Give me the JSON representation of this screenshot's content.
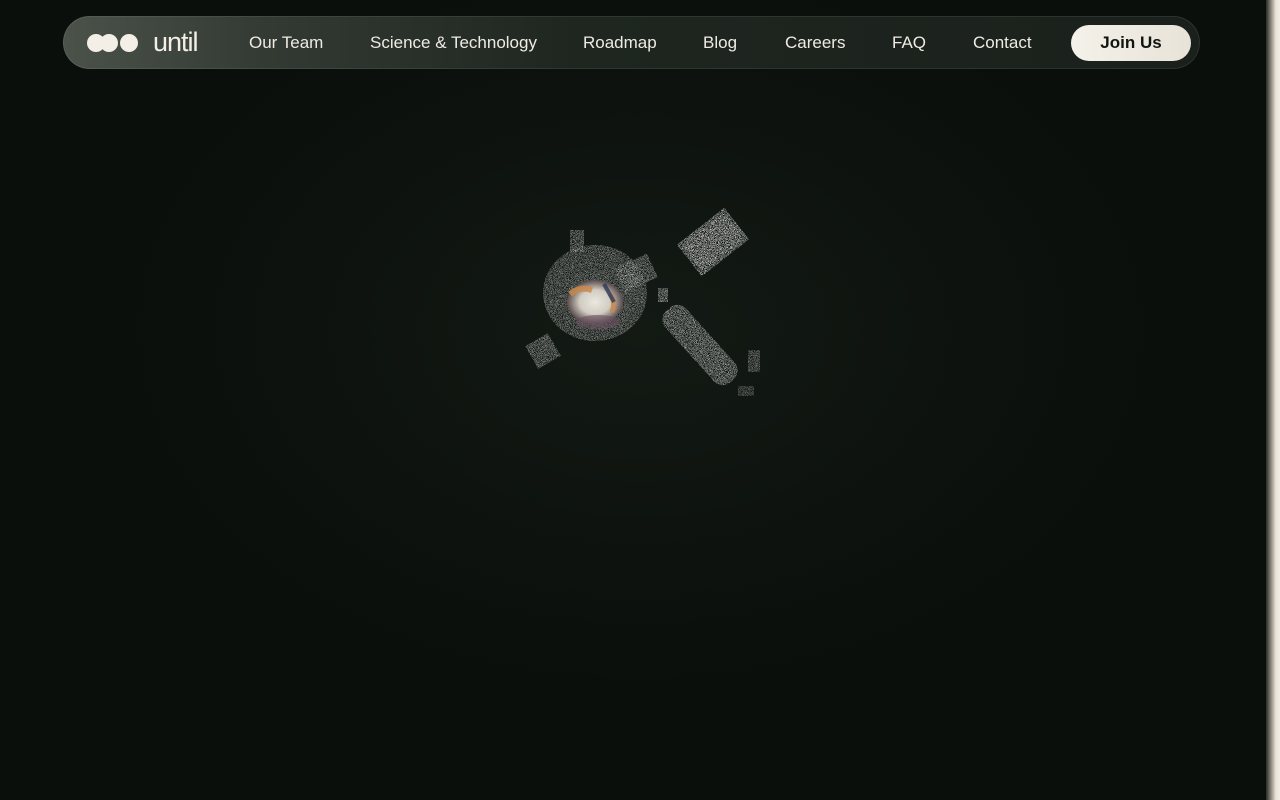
{
  "brand": {
    "name": "until"
  },
  "nav": {
    "items": [
      {
        "label": "Our Team"
      },
      {
        "label": "Science & Technology"
      },
      {
        "label": "Roadmap"
      },
      {
        "label": "Blog"
      },
      {
        "label": "Careers"
      },
      {
        "label": "FAQ"
      },
      {
        "label": "Contact"
      }
    ],
    "cta_label": "Join Us"
  },
  "colors": {
    "background": "#0d110d",
    "nav_background": "#1f2620",
    "text_light": "#eeebe3",
    "cta_background": "#f4f1ea",
    "cta_text": "#111511"
  },
  "icons": {
    "logo": "three-dots-logo-icon"
  }
}
